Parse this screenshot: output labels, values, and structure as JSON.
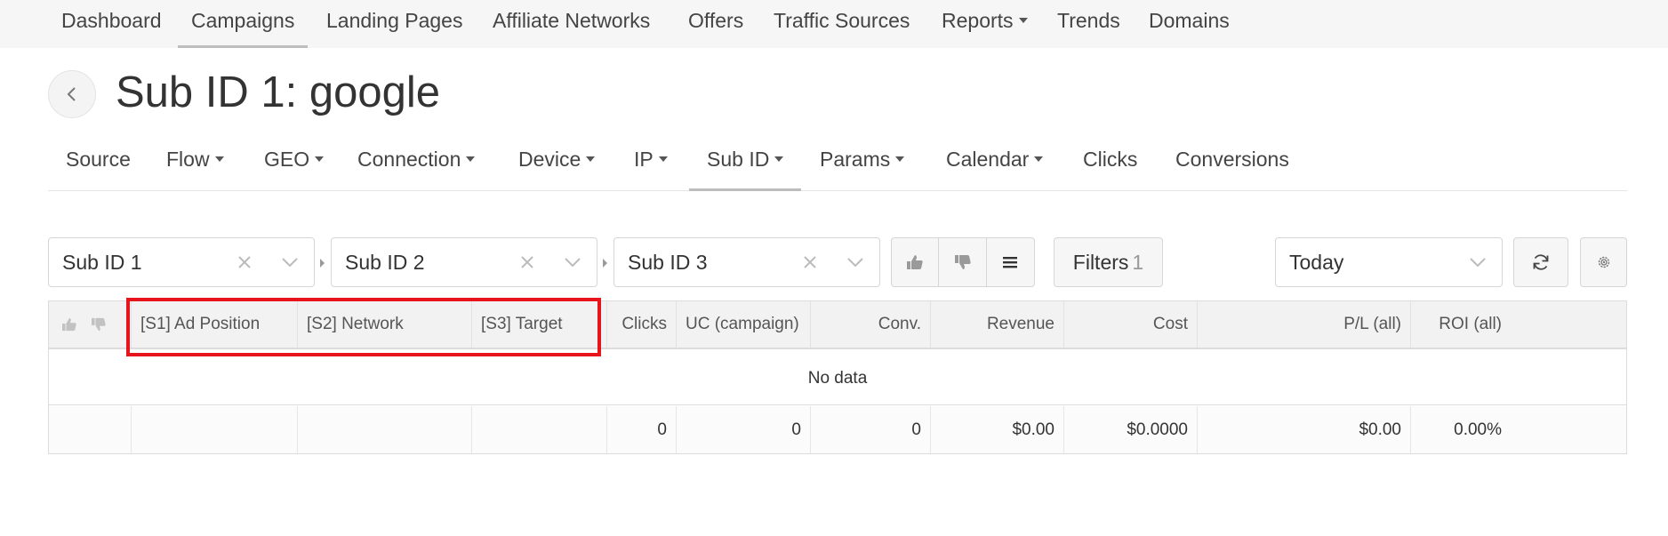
{
  "top_nav": {
    "items": [
      {
        "label": "Dashboard"
      },
      {
        "label": "Campaigns",
        "active": true
      },
      {
        "label": "Landing Pages"
      },
      {
        "label": "Affiliate Networks"
      },
      {
        "label": "Offers"
      },
      {
        "label": "Traffic Sources"
      },
      {
        "label": "Reports",
        "dropdown": true
      },
      {
        "label": "Trends"
      },
      {
        "label": "Domains"
      }
    ]
  },
  "page": {
    "title": "Sub ID 1: google"
  },
  "report_tabs": {
    "items": [
      {
        "label": "Source"
      },
      {
        "label": "Flow",
        "dropdown": true
      },
      {
        "label": "GEO",
        "dropdown": true
      },
      {
        "label": "Connection",
        "dropdown": true
      },
      {
        "label": "Device",
        "dropdown": true
      },
      {
        "label": "IP",
        "dropdown": true
      },
      {
        "label": "Sub ID",
        "dropdown": true,
        "active": true
      },
      {
        "label": "Params",
        "dropdown": true
      },
      {
        "label": "Calendar",
        "dropdown": true
      },
      {
        "label": "Clicks"
      },
      {
        "label": "Conversions"
      }
    ]
  },
  "toolbar": {
    "grouping_1": "Sub ID 1",
    "grouping_2": "Sub ID 2",
    "grouping_3": "Sub ID 3",
    "filters_label": "Filters",
    "filters_count": "1",
    "date_range": "Today"
  },
  "table": {
    "headers": {
      "s1": "[S1] Ad Position",
      "s2": "[S2] Network",
      "s3": "[S3] Target",
      "clicks": "Clicks",
      "uc": "UC (campaign)",
      "conv": "Conv.",
      "revenue": "Revenue",
      "cost": "Cost",
      "pl": "P/L (all)",
      "roi": "ROI (all)"
    },
    "empty_message": "No data",
    "totals": {
      "clicks": "0",
      "uc": "0",
      "conv": "0",
      "revenue": "$0.00",
      "cost": "$0.0000",
      "pl": "$0.00",
      "roi": "0.00%"
    }
  },
  "colors": {
    "highlight": "#e8141c",
    "nav_background": "#f6f6f6",
    "header_background": "#f2f2f2"
  }
}
